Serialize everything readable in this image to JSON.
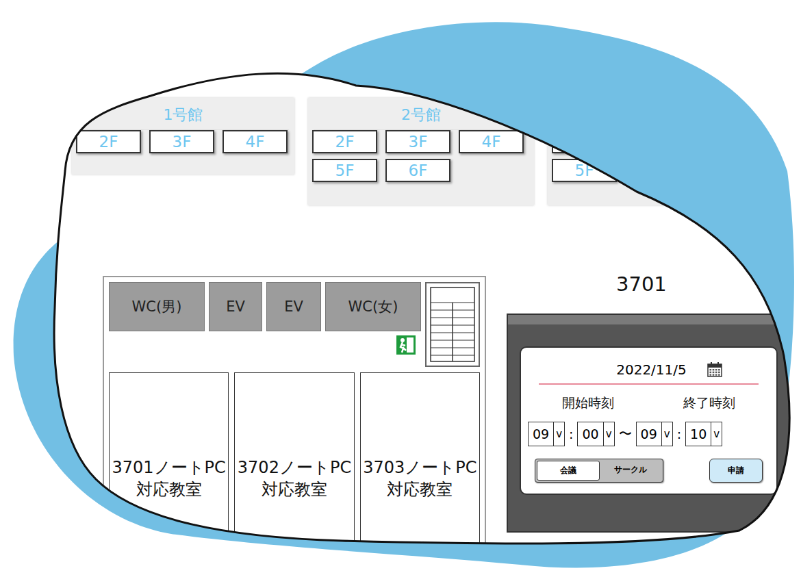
{
  "buildings": [
    {
      "title": "1号館",
      "rows": [
        [
          "2F",
          "3F",
          "4F"
        ]
      ]
    },
    {
      "title": "2号館",
      "rows": [
        [
          "2F",
          "3F",
          "4F"
        ],
        [
          "5F",
          "6F"
        ]
      ]
    },
    {
      "rows": [
        [
          ""
        ],
        [
          "5F"
        ]
      ]
    }
  ],
  "floor_plan": {
    "facilities": [
      "WC(男)",
      "EV",
      "EV",
      "WC(女)"
    ],
    "rooms": [
      {
        "lines": [
          "3701ノートPC",
          "対応教室"
        ]
      },
      {
        "lines": [
          "3702ノートPC",
          "対応教室"
        ]
      },
      {
        "lines": [
          "3703ノートPC",
          "対応教室"
        ]
      }
    ]
  },
  "booking": {
    "room": "3701",
    "date": "2022/11/5",
    "start_label": "開始時刻",
    "end_label": "終了時刻",
    "start": {
      "hour": "09",
      "minute": "00"
    },
    "end": {
      "hour": "09",
      "minute": "10"
    },
    "separator": ":",
    "range": "〜",
    "dropdown_glyph": "v",
    "purposes": [
      {
        "label": "会議",
        "selected": true
      },
      {
        "label": "サークル",
        "selected": false
      }
    ],
    "submit": "申請"
  }
}
